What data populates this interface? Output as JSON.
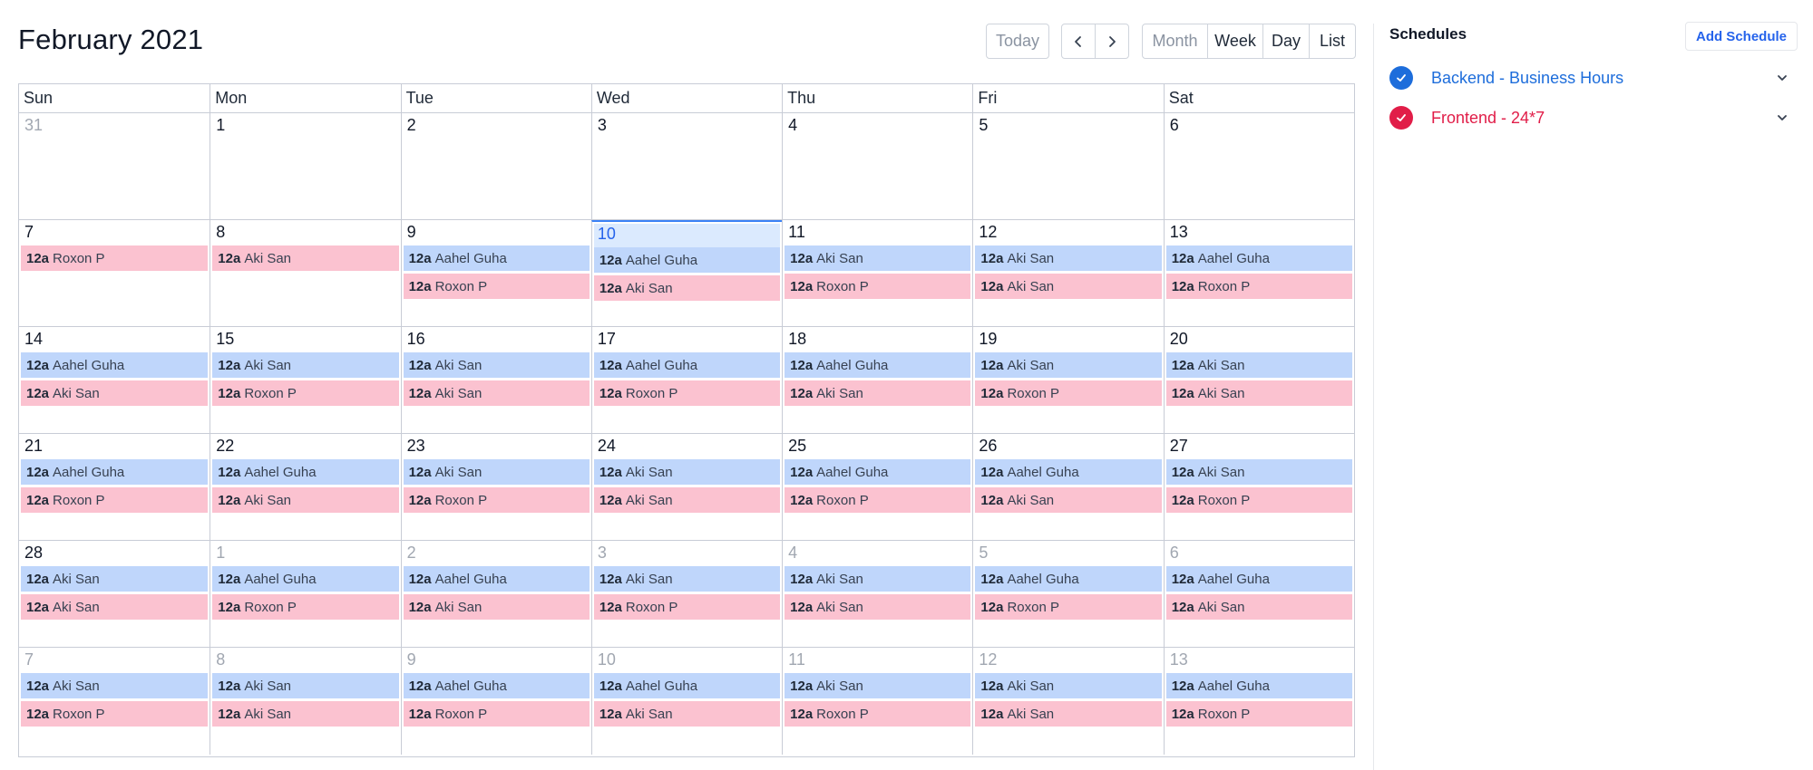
{
  "header": {
    "title": "February 2021",
    "today_label": "Today",
    "views": [
      "Month",
      "Week",
      "Day",
      "List"
    ]
  },
  "colors": {
    "blue_event": "#bfd6fb",
    "pink_event": "#fbc2d0",
    "backend": "#1d6ddb",
    "frontend": "#e11d48"
  },
  "calendar": {
    "days_of_week": [
      "Sun",
      "Mon",
      "Tue",
      "Wed",
      "Thu",
      "Fri",
      "Sat"
    ],
    "weeks": [
      [
        {
          "day": "31",
          "other": true,
          "events": []
        },
        {
          "day": "1",
          "events": []
        },
        {
          "day": "2",
          "events": []
        },
        {
          "day": "3",
          "events": []
        },
        {
          "day": "4",
          "events": []
        },
        {
          "day": "5",
          "events": []
        },
        {
          "day": "6",
          "events": []
        }
      ],
      [
        {
          "day": "7",
          "events": [
            {
              "time": "12a",
              "name": "Roxon P",
              "color": "pink"
            }
          ]
        },
        {
          "day": "8",
          "events": [
            {
              "time": "12a",
              "name": "Aki San",
              "color": "pink"
            }
          ]
        },
        {
          "day": "9",
          "events": [
            {
              "time": "12a",
              "name": "Aahel Guha",
              "color": "blue"
            },
            {
              "time": "12a",
              "name": "Roxon P",
              "color": "pink"
            }
          ]
        },
        {
          "day": "10",
          "today": true,
          "events": [
            {
              "time": "12a",
              "name": "Aahel Guha",
              "color": "blue"
            },
            {
              "time": "12a",
              "name": "Aki San",
              "color": "pink"
            }
          ]
        },
        {
          "day": "11",
          "events": [
            {
              "time": "12a",
              "name": "Aki San",
              "color": "blue"
            },
            {
              "time": "12a",
              "name": "Roxon P",
              "color": "pink"
            }
          ]
        },
        {
          "day": "12",
          "events": [
            {
              "time": "12a",
              "name": "Aki San",
              "color": "blue"
            },
            {
              "time": "12a",
              "name": "Aki San",
              "color": "pink"
            }
          ]
        },
        {
          "day": "13",
          "events": [
            {
              "time": "12a",
              "name": "Aahel Guha",
              "color": "blue"
            },
            {
              "time": "12a",
              "name": "Roxon P",
              "color": "pink"
            }
          ]
        }
      ],
      [
        {
          "day": "14",
          "events": [
            {
              "time": "12a",
              "name": "Aahel Guha",
              "color": "blue"
            },
            {
              "time": "12a",
              "name": "Aki San",
              "color": "pink"
            }
          ]
        },
        {
          "day": "15",
          "events": [
            {
              "time": "12a",
              "name": "Aki San",
              "color": "blue"
            },
            {
              "time": "12a",
              "name": "Roxon P",
              "color": "pink"
            }
          ]
        },
        {
          "day": "16",
          "events": [
            {
              "time": "12a",
              "name": "Aki San",
              "color": "blue"
            },
            {
              "time": "12a",
              "name": "Aki San",
              "color": "pink"
            }
          ]
        },
        {
          "day": "17",
          "events": [
            {
              "time": "12a",
              "name": "Aahel Guha",
              "color": "blue"
            },
            {
              "time": "12a",
              "name": "Roxon P",
              "color": "pink"
            }
          ]
        },
        {
          "day": "18",
          "events": [
            {
              "time": "12a",
              "name": "Aahel Guha",
              "color": "blue"
            },
            {
              "time": "12a",
              "name": "Aki San",
              "color": "pink"
            }
          ]
        },
        {
          "day": "19",
          "events": [
            {
              "time": "12a",
              "name": "Aki San",
              "color": "blue"
            },
            {
              "time": "12a",
              "name": "Roxon P",
              "color": "pink"
            }
          ]
        },
        {
          "day": "20",
          "events": [
            {
              "time": "12a",
              "name": "Aki San",
              "color": "blue"
            },
            {
              "time": "12a",
              "name": "Aki San",
              "color": "pink"
            }
          ]
        }
      ],
      [
        {
          "day": "21",
          "events": [
            {
              "time": "12a",
              "name": "Aahel Guha",
              "color": "blue"
            },
            {
              "time": "12a",
              "name": "Roxon P",
              "color": "pink"
            }
          ]
        },
        {
          "day": "22",
          "events": [
            {
              "time": "12a",
              "name": "Aahel Guha",
              "color": "blue"
            },
            {
              "time": "12a",
              "name": "Aki San",
              "color": "pink"
            }
          ]
        },
        {
          "day": "23",
          "events": [
            {
              "time": "12a",
              "name": "Aki San",
              "color": "blue"
            },
            {
              "time": "12a",
              "name": "Roxon P",
              "color": "pink"
            }
          ]
        },
        {
          "day": "24",
          "events": [
            {
              "time": "12a",
              "name": "Aki San",
              "color": "blue"
            },
            {
              "time": "12a",
              "name": "Aki San",
              "color": "pink"
            }
          ]
        },
        {
          "day": "25",
          "events": [
            {
              "time": "12a",
              "name": "Aahel Guha",
              "color": "blue"
            },
            {
              "time": "12a",
              "name": "Roxon P",
              "color": "pink"
            }
          ]
        },
        {
          "day": "26",
          "events": [
            {
              "time": "12a",
              "name": "Aahel Guha",
              "color": "blue"
            },
            {
              "time": "12a",
              "name": "Aki San",
              "color": "pink"
            }
          ]
        },
        {
          "day": "27",
          "events": [
            {
              "time": "12a",
              "name": "Aki San",
              "color": "blue"
            },
            {
              "time": "12a",
              "name": "Roxon P",
              "color": "pink"
            }
          ]
        }
      ],
      [
        {
          "day": "28",
          "events": [
            {
              "time": "12a",
              "name": "Aki San",
              "color": "blue"
            },
            {
              "time": "12a",
              "name": "Aki San",
              "color": "pink"
            }
          ]
        },
        {
          "day": "1",
          "other": true,
          "events": [
            {
              "time": "12a",
              "name": "Aahel Guha",
              "color": "blue"
            },
            {
              "time": "12a",
              "name": "Roxon P",
              "color": "pink"
            }
          ]
        },
        {
          "day": "2",
          "other": true,
          "events": [
            {
              "time": "12a",
              "name": "Aahel Guha",
              "color": "blue"
            },
            {
              "time": "12a",
              "name": "Aki San",
              "color": "pink"
            }
          ]
        },
        {
          "day": "3",
          "other": true,
          "events": [
            {
              "time": "12a",
              "name": "Aki San",
              "color": "blue"
            },
            {
              "time": "12a",
              "name": "Roxon P",
              "color": "pink"
            }
          ]
        },
        {
          "day": "4",
          "other": true,
          "events": [
            {
              "time": "12a",
              "name": "Aki San",
              "color": "blue"
            },
            {
              "time": "12a",
              "name": "Aki San",
              "color": "pink"
            }
          ]
        },
        {
          "day": "5",
          "other": true,
          "events": [
            {
              "time": "12a",
              "name": "Aahel Guha",
              "color": "blue"
            },
            {
              "time": "12a",
              "name": "Roxon P",
              "color": "pink"
            }
          ]
        },
        {
          "day": "6",
          "other": true,
          "events": [
            {
              "time": "12a",
              "name": "Aahel Guha",
              "color": "blue"
            },
            {
              "time": "12a",
              "name": "Aki San",
              "color": "pink"
            }
          ]
        }
      ],
      [
        {
          "day": "7",
          "other": true,
          "events": [
            {
              "time": "12a",
              "name": "Aki San",
              "color": "blue"
            },
            {
              "time": "12a",
              "name": "Roxon P",
              "color": "pink"
            }
          ]
        },
        {
          "day": "8",
          "other": true,
          "events": [
            {
              "time": "12a",
              "name": "Aki San",
              "color": "blue"
            },
            {
              "time": "12a",
              "name": "Aki San",
              "color": "pink"
            }
          ]
        },
        {
          "day": "9",
          "other": true,
          "events": [
            {
              "time": "12a",
              "name": "Aahel Guha",
              "color": "blue"
            },
            {
              "time": "12a",
              "name": "Roxon P",
              "color": "pink"
            }
          ]
        },
        {
          "day": "10",
          "other": true,
          "events": [
            {
              "time": "12a",
              "name": "Aahel Guha",
              "color": "blue"
            },
            {
              "time": "12a",
              "name": "Aki San",
              "color": "pink"
            }
          ]
        },
        {
          "day": "11",
          "other": true,
          "events": [
            {
              "time": "12a",
              "name": "Aki San",
              "color": "blue"
            },
            {
              "time": "12a",
              "name": "Roxon P",
              "color": "pink"
            }
          ]
        },
        {
          "day": "12",
          "other": true,
          "events": [
            {
              "time": "12a",
              "name": "Aki San",
              "color": "blue"
            },
            {
              "time": "12a",
              "name": "Aki San",
              "color": "pink"
            }
          ]
        },
        {
          "day": "13",
          "other": true,
          "events": [
            {
              "time": "12a",
              "name": "Aahel Guha",
              "color": "blue"
            },
            {
              "time": "12a",
              "name": "Roxon P",
              "color": "pink"
            }
          ]
        }
      ]
    ]
  },
  "sidebar": {
    "title": "Schedules",
    "add_label": "Add Schedule",
    "schedules": [
      {
        "name": "Backend - Business Hours",
        "color": "#1d6ddb",
        "icon": "check-icon"
      },
      {
        "name": "Frontend - 24*7",
        "color": "#e11d48",
        "icon": "check-icon"
      }
    ]
  }
}
